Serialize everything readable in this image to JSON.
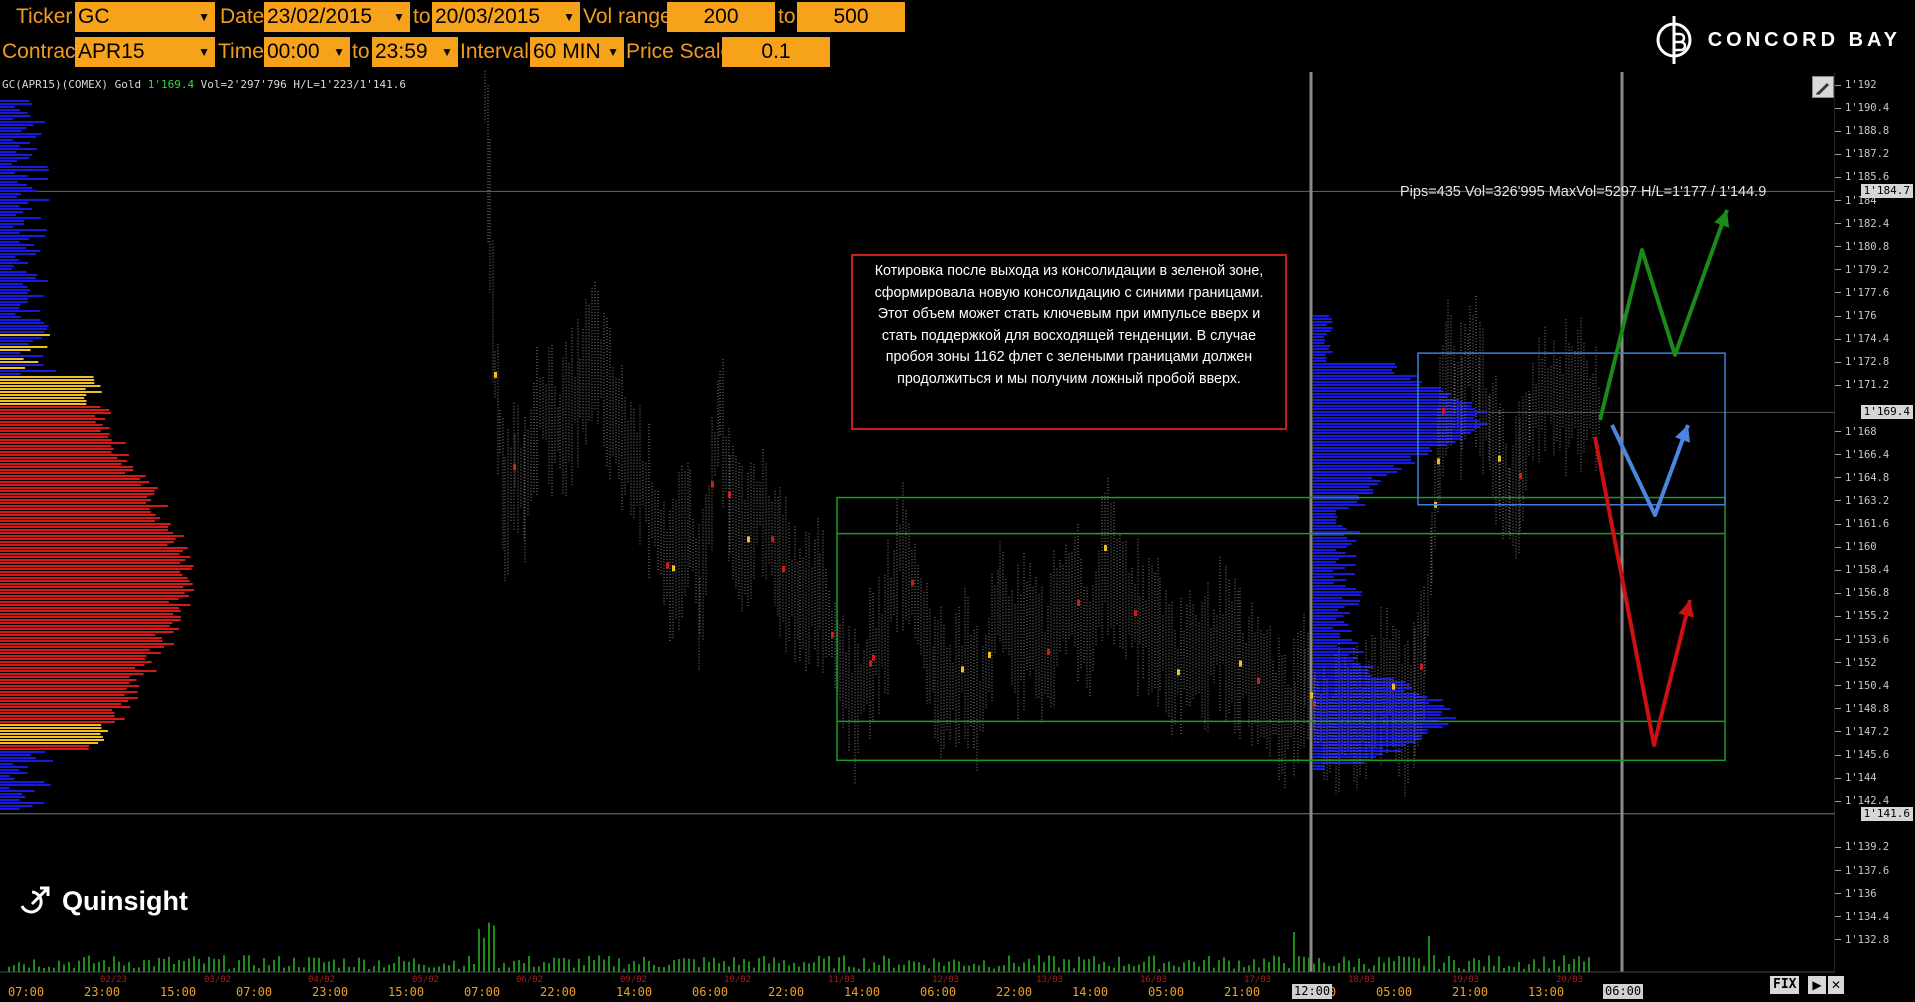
{
  "toolbar": {
    "row1": {
      "ticker_label": "Ticker",
      "ticker_value": "GC",
      "date_label": "Date",
      "date_from": "23/02/2015",
      "to_label": "to",
      "date_to": "20/03/2015",
      "vol_range_label": "Vol range",
      "vol_from": "200",
      "vol_to_label": "to",
      "vol_to": "500"
    },
    "row2": {
      "contract_label": "Contract",
      "contract_value": "APR15",
      "time_label": "Time",
      "time_from": "00:00",
      "to_label": "to",
      "time_to": "23:59",
      "interval_label": "Interval",
      "interval_value": "60 MIN",
      "price_scale_label": "Price Scale",
      "price_scale_value": "0.1"
    },
    "dropdown_icon": "caret-down-icon"
  },
  "brand": {
    "name": "CONCORD BAY",
    "logo_icon": "concord-bay-logo-icon"
  },
  "watermark": {
    "name": "Quinsight",
    "icon": "quinsight-logo-icon"
  },
  "info_line": {
    "prefix": "GC(APR15)(COMEX) Gold ",
    "last_price": "1'169.4",
    "suffix": " Vol=2'297'796 H/L=1'223/1'141.6"
  },
  "annotation": {
    "text": "Котировка после выхода из консолидации в зеленой зоне, сформировала новую консолидацию с синими границами. Этот объем может стать ключевым при импульсе вверх и стать поддержкой для восходящей тенденции. В случае пробоя зоны 1162 флет с зелеными границами должен продолжиться и мы получим ложный пробой вверх."
  },
  "range_stats": "Pips=435 Vol=326'995 MaxVol=5297 H/L=1'177 / 1'144.9",
  "chart_data": {
    "type": "candlestick-volume-profile",
    "instrument": "GC(APR15)(COMEX) Gold",
    "y_ticks": [
      "1'192",
      "1'190.4",
      "1'188.8",
      "1'187.2",
      "1'185.6",
      "1'184",
      "1'182.4",
      "1'180.8",
      "1'179.2",
      "1'177.6",
      "1'176",
      "1'174.4",
      "1'172.8",
      "1'171.2",
      "1'168",
      "1'166.4",
      "1'164.8",
      "1'163.2",
      "1'161.6",
      "1'160",
      "1'158.4",
      "1'156.8",
      "1'155.2",
      "1'153.6",
      "1'152",
      "1'150.4",
      "1'148.8",
      "1'147.2",
      "1'145.6",
      "1'144",
      "1'142.4",
      "1'139.2",
      "1'137.6",
      "1'136",
      "1'134.4",
      "1'132.8"
    ],
    "y_tags": {
      "high_line": "1'184.7",
      "last_price": "1'169.4",
      "low_line": "1'141.6"
    },
    "x_dates": [
      "02/23",
      "03/02",
      "04/02",
      "05/02",
      "06/02",
      "09/02",
      "10/02",
      "11/03",
      "12/03",
      "13/03",
      "16/03",
      "17/03",
      "18/03",
      "19/03",
      "20/03"
    ],
    "x_times": [
      "07:00",
      "23:00",
      "15:00",
      "07:00",
      "23:00",
      "15:00",
      "07:00",
      "22:00",
      "14:00",
      "06:00",
      "22:00",
      "14:00",
      "06:00",
      "22:00",
      "14:00",
      "05:00",
      "21:00",
      "13:00",
      "05:00",
      "21:00",
      "13:00"
    ],
    "x_tags": [
      "12:00",
      "06:00"
    ],
    "zones": {
      "green_consolidation": {
        "price_high": 1163.5,
        "price_low": 1145.3,
        "inner_high": 1161.0,
        "inner_low": 1148.0
      },
      "blue_consolidation": {
        "price_high": 1173.5,
        "price_low": 1163.0
      }
    },
    "scenario_arrows": {
      "green": "up-down-up",
      "blue": "down-up",
      "red": "down-up"
    },
    "colors": {
      "background": "#000000",
      "toolbar_field": "#f7a21b",
      "toolbar_label": "#f29c1f",
      "profile_main": "#d21a1a",
      "profile_value_area_edge": "#f0c020",
      "profile_secondary": "#1a1adf",
      "green_zone": "#1e9a2a",
      "blue_zone": "#3d7fd8",
      "arrow_green": "#1a8a1a",
      "arrow_blue": "#4a86e0",
      "arrow_red": "#cc1111",
      "annotation_border": "#cc1b1b",
      "volume_bars": "#1d8c1d"
    }
  },
  "controls": {
    "fix_label": "FIX",
    "pencil_icon": "pencil-icon",
    "expand_icon": "chevron-right-icon"
  }
}
